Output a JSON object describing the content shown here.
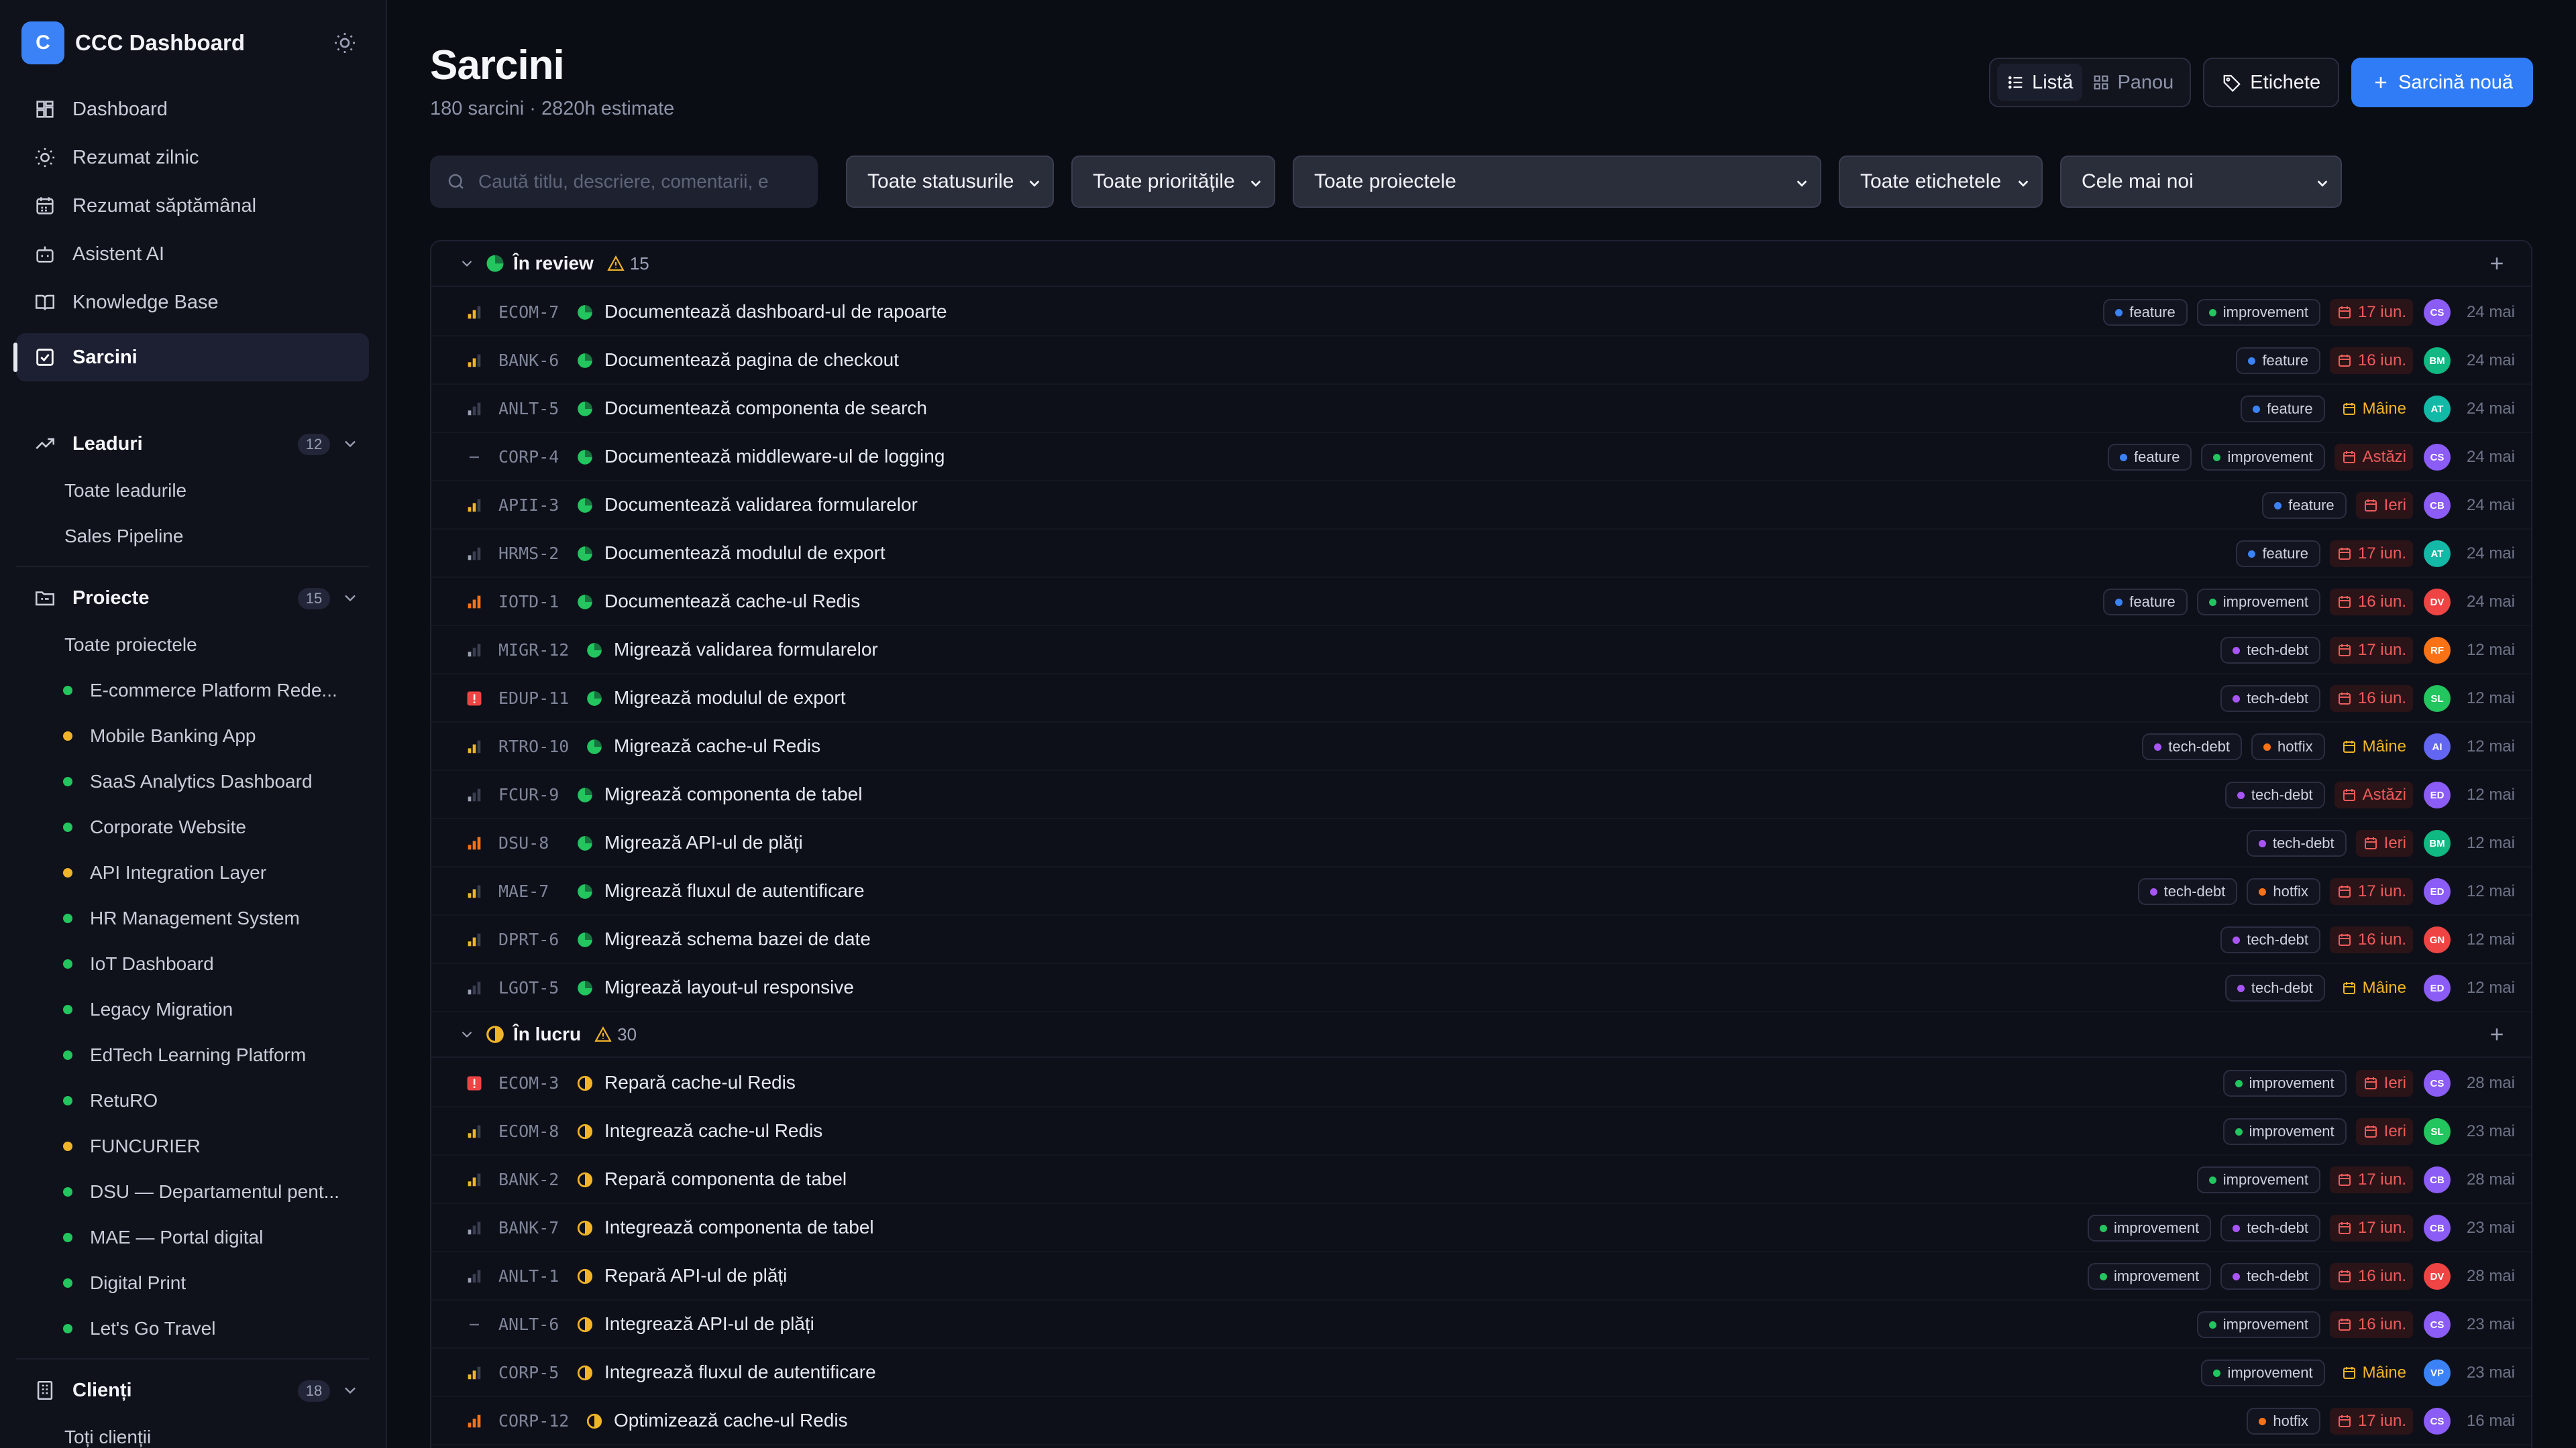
{
  "app": {
    "initial": "C",
    "name": "CCC Dashboard"
  },
  "nav": [
    {
      "label": "Dashboard",
      "icon": "dashboard-icon"
    },
    {
      "label": "Rezumat zilnic",
      "icon": "sun-icon"
    },
    {
      "label": "Rezumat săptămânal",
      "icon": "calendar-icon"
    },
    {
      "label": "Asistent AI",
      "icon": "bot-icon"
    },
    {
      "label": "Knowledge Base",
      "icon": "book-icon"
    },
    {
      "label": "Sarcini",
      "icon": "checkbox-icon",
      "active": true
    }
  ],
  "leads": {
    "label": "Leaduri",
    "count": "12",
    "items": [
      "Toate leadurile",
      "Sales Pipeline"
    ]
  },
  "projects": {
    "label": "Proiecte",
    "count": "15",
    "all": "Toate proiectele",
    "items": [
      {
        "name": "E-commerce Platform Rede...",
        "color": "#22c55e"
      },
      {
        "name": "Mobile Banking App",
        "color": "#f0b429"
      },
      {
        "name": "SaaS Analytics Dashboard",
        "color": "#22c55e"
      },
      {
        "name": "Corporate Website",
        "color": "#22c55e"
      },
      {
        "name": "API Integration Layer",
        "color": "#f0b429"
      },
      {
        "name": "HR Management System",
        "color": "#22c55e"
      },
      {
        "name": "IoT Dashboard",
        "color": "#22c55e"
      },
      {
        "name": "Legacy Migration",
        "color": "#22c55e"
      },
      {
        "name": "EdTech Learning Platform",
        "color": "#22c55e"
      },
      {
        "name": "RetuRO",
        "color": "#22c55e"
      },
      {
        "name": "FUNCURIER",
        "color": "#f0b429"
      },
      {
        "name": "DSU — Departamentul pent...",
        "color": "#22c55e"
      },
      {
        "name": "MAE — Portal digital",
        "color": "#22c55e"
      },
      {
        "name": "Digital Print",
        "color": "#22c55e"
      },
      {
        "name": "Let's Go Travel",
        "color": "#22c55e"
      }
    ]
  },
  "clients": {
    "label": "Clienți",
    "count": "18",
    "items": [
      "Toți clienții"
    ]
  },
  "page": {
    "title": "Sarcini",
    "subtitle": "180 sarcini · 2820h estimate"
  },
  "toolbar": {
    "list": "Listă",
    "board": "Panou",
    "labels": "Etichete",
    "new_task": "Sarcină nouă"
  },
  "filters": {
    "search_placeholder": "Caută titlu, descriere, comentarii, e",
    "status": "Toate statusurile",
    "priority": "Toate prioritățile",
    "project": "Toate proiectele",
    "labels": "Toate etichetele",
    "sort": "Cele mai noi"
  },
  "colors": {
    "accent": "#2f7cf6",
    "review": "#22c55e",
    "in_progress": "#f0b429",
    "overdue": "#ef5b5b",
    "feature": "#3b82f6",
    "improvement": "#22c55e",
    "tech-debt": "#a855f7",
    "hotfix": "#f97316"
  },
  "groups": [
    {
      "name": "În review",
      "status": "review",
      "warn": "15",
      "tasks": [
        {
          "key": "ECOM-7",
          "prio": "medium",
          "title": "Documentează dashboard-ul de rapoarte",
          "tags": [
            "feature",
            "improvement"
          ],
          "due": "17 iun.",
          "due_state": "late",
          "avatar": "CS",
          "avatar_color": "#8b5cf6",
          "created": "24 mai"
        },
        {
          "key": "BANK-6",
          "prio": "medium",
          "title": "Documentează pagina de checkout",
          "tags": [
            "feature"
          ],
          "due": "16 iun.",
          "due_state": "late",
          "avatar": "BM",
          "avatar_color": "#10b981",
          "created": "24 mai"
        },
        {
          "key": "ANLT-5",
          "prio": "low",
          "title": "Documentează componenta de search",
          "tags": [
            "feature"
          ],
          "due": "Mâine",
          "due_state": "soon",
          "avatar": "AT",
          "avatar_color": "#14b8a6",
          "created": "24 mai"
        },
        {
          "key": "CORP-4",
          "prio": "none",
          "title": "Documentează middleware-ul de logging",
          "tags": [
            "feature",
            "improvement"
          ],
          "due": "Astăzi",
          "due_state": "late",
          "avatar": "CS",
          "avatar_color": "#8b5cf6",
          "created": "24 mai"
        },
        {
          "key": "APII-3",
          "prio": "medium",
          "title": "Documentează validarea formularelor",
          "tags": [
            "feature"
          ],
          "due": "Ieri",
          "due_state": "late",
          "avatar": "CB",
          "avatar_color": "#8b5cf6",
          "created": "24 mai"
        },
        {
          "key": "HRMS-2",
          "prio": "low",
          "title": "Documentează modulul de export",
          "tags": [
            "feature"
          ],
          "due": "17 iun.",
          "due_state": "late",
          "avatar": "AT",
          "avatar_color": "#14b8a6",
          "created": "24 mai"
        },
        {
          "key": "IOTD-1",
          "prio": "high",
          "title": "Documentează cache-ul Redis",
          "tags": [
            "feature",
            "improvement"
          ],
          "due": "16 iun.",
          "due_state": "late",
          "avatar": "DV",
          "avatar_color": "#ef4444",
          "created": "24 mai"
        },
        {
          "key": "MIGR-12",
          "prio": "low",
          "title": "Migrează validarea formularelor",
          "tags": [
            "tech-debt"
          ],
          "due": "17 iun.",
          "due_state": "late",
          "avatar": "RF",
          "avatar_color": "#f97316",
          "created": "12 mai"
        },
        {
          "key": "EDUP-11",
          "prio": "urgent",
          "title": "Migrează modulul de export",
          "tags": [
            "tech-debt"
          ],
          "due": "16 iun.",
          "due_state": "late",
          "avatar": "SL",
          "avatar_color": "#22c55e",
          "created": "12 mai"
        },
        {
          "key": "RTRO-10",
          "prio": "medium",
          "title": "Migrează cache-ul Redis",
          "tags": [
            "tech-debt",
            "hotfix"
          ],
          "due": "Mâine",
          "due_state": "soon",
          "avatar": "AI",
          "avatar_color": "#6366f1",
          "created": "12 mai"
        },
        {
          "key": "FCUR-9",
          "prio": "low",
          "title": "Migrează componenta de tabel",
          "tags": [
            "tech-debt"
          ],
          "due": "Astăzi",
          "due_state": "late",
          "avatar": "ED",
          "avatar_color": "#8b5cf6",
          "created": "12 mai"
        },
        {
          "key": "DSU-8",
          "prio": "high",
          "title": "Migrează API-ul de plăți",
          "tags": [
            "tech-debt"
          ],
          "due": "Ieri",
          "due_state": "late",
          "avatar": "BM",
          "avatar_color": "#10b981",
          "created": "12 mai"
        },
        {
          "key": "MAE-7",
          "prio": "medium",
          "title": "Migrează fluxul de autentificare",
          "tags": [
            "tech-debt",
            "hotfix"
          ],
          "due": "17 iun.",
          "due_state": "late",
          "avatar": "ED",
          "avatar_color": "#8b5cf6",
          "created": "12 mai"
        },
        {
          "key": "DPRT-6",
          "prio": "medium",
          "title": "Migrează schema bazei de date",
          "tags": [
            "tech-debt"
          ],
          "due": "16 iun.",
          "due_state": "late",
          "avatar": "GN",
          "avatar_color": "#ef4444",
          "created": "12 mai"
        },
        {
          "key": "LGOT-5",
          "prio": "low",
          "title": "Migrează layout-ul responsive",
          "tags": [
            "tech-debt"
          ],
          "due": "Mâine",
          "due_state": "soon",
          "avatar": "ED",
          "avatar_color": "#8b5cf6",
          "created": "12 mai"
        }
      ]
    },
    {
      "name": "În lucru",
      "status": "progress",
      "warn": "30",
      "tasks": [
        {
          "key": "ECOM-3",
          "prio": "urgent",
          "title": "Repară cache-ul Redis",
          "tags": [
            "improvement"
          ],
          "due": "Ieri",
          "due_state": "late",
          "avatar": "CS",
          "avatar_color": "#8b5cf6",
          "created": "28 mai"
        },
        {
          "key": "ECOM-8",
          "prio": "medium",
          "title": "Integrează cache-ul Redis",
          "tags": [
            "improvement"
          ],
          "due": "Ieri",
          "due_state": "late",
          "avatar": "SL",
          "avatar_color": "#22c55e",
          "created": "23 mai"
        },
        {
          "key": "BANK-2",
          "prio": "medium",
          "title": "Repară componenta de tabel",
          "tags": [
            "improvement"
          ],
          "due": "17 iun.",
          "due_state": "late",
          "avatar": "CB",
          "avatar_color": "#8b5cf6",
          "created": "28 mai"
        },
        {
          "key": "BANK-7",
          "prio": "low",
          "title": "Integrează componenta de tabel",
          "tags": [
            "improvement",
            "tech-debt"
          ],
          "due": "17 iun.",
          "due_state": "late",
          "avatar": "CB",
          "avatar_color": "#8b5cf6",
          "created": "23 mai"
        },
        {
          "key": "ANLT-1",
          "prio": "low",
          "title": "Repară API-ul de plăți",
          "tags": [
            "improvement",
            "tech-debt"
          ],
          "due": "16 iun.",
          "due_state": "late",
          "avatar": "DV",
          "avatar_color": "#ef4444",
          "created": "28 mai"
        },
        {
          "key": "ANLT-6",
          "prio": "none",
          "title": "Integrează API-ul de plăți",
          "tags": [
            "improvement"
          ],
          "due": "16 iun.",
          "due_state": "late",
          "avatar": "CS",
          "avatar_color": "#8b5cf6",
          "created": "23 mai"
        },
        {
          "key": "CORP-5",
          "prio": "medium",
          "title": "Integrează fluxul de autentificare",
          "tags": [
            "improvement"
          ],
          "due": "Mâine",
          "due_state": "soon",
          "avatar": "VP",
          "avatar_color": "#3b82f6",
          "created": "23 mai"
        },
        {
          "key": "CORP-12",
          "prio": "high",
          "title": "Optimizează cache-ul Redis",
          "tags": [
            "hotfix"
          ],
          "due": "17 iun.",
          "due_state": "late",
          "avatar": "CS",
          "avatar_color": "#8b5cf6",
          "created": "16 mai"
        }
      ]
    }
  ]
}
